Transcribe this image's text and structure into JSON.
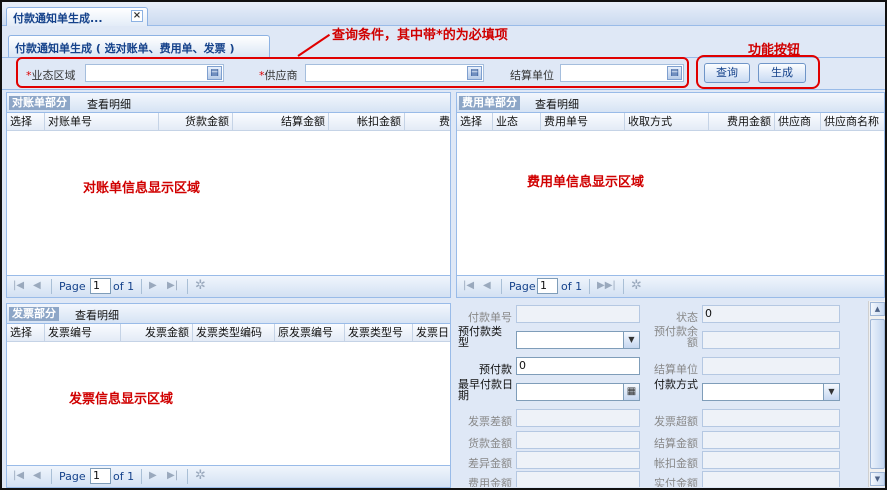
{
  "window": {
    "tab_title": "付款通知单生成...",
    "tab_close": "×"
  },
  "query_panel": {
    "tab_title": "付款通知单生成 ( 选对账单、费用单、发票 )",
    "required_mark": "*",
    "fields": [
      {
        "label": "业态区域",
        "required": true,
        "value": ""
      },
      {
        "label": "供应商",
        "required": true,
        "value": ""
      },
      {
        "label": "结算单位",
        "required": false,
        "value": ""
      }
    ],
    "buttons": {
      "query": "查询",
      "generate": "生成"
    }
  },
  "annotations": {
    "query_note": "查询条件，其中带*的为必填项",
    "button_note": "功能按钮"
  },
  "pager": {
    "page_label": "Page",
    "page_value": "1",
    "of_label": "of 1"
  },
  "statement_panel": {
    "title": "对账单部分",
    "detail_link": "查看明细",
    "columns": [
      "选择",
      "对账单号",
      "货款金额",
      "结算金额",
      "帐扣金额",
      "费"
    ],
    "area_label": "对账单信息显示区域"
  },
  "expense_panel": {
    "title": "费用单部分",
    "detail_link": "查看明细",
    "columns": [
      "选择",
      "业态",
      "费用单号",
      "收取方式",
      "费用金额",
      "供应商",
      "供应商名称"
    ],
    "area_label": "费用单信息显示区域"
  },
  "invoice_panel": {
    "title": "发票部分",
    "detail_link": "查看明细",
    "columns": [
      "选择",
      "发票编号",
      "发票金额",
      "发票类型编码",
      "原发票编号",
      "发票类型号",
      "发票日"
    ],
    "area_label": "发票信息显示区域"
  },
  "payment_form": {
    "payment_no": {
      "label": "付款单号",
      "value": ""
    },
    "status": {
      "label": "状态",
      "value": "0"
    },
    "prepay_type": {
      "label": "预付款类型",
      "value": ""
    },
    "prepay_balance": {
      "label": "预付款余额",
      "value": ""
    },
    "prepay": {
      "label": "预付款",
      "value": "0"
    },
    "settle_unit": {
      "label": "结算单位",
      "value": ""
    },
    "earliest_date": {
      "label": "最早付款日期",
      "value": ""
    },
    "pay_method": {
      "label": "付款方式",
      "value": ""
    },
    "invoice_diff": {
      "label": "发票差额",
      "value": ""
    },
    "invoice_over": {
      "label": "发票超额",
      "value": ""
    },
    "goods_amount": {
      "label": "货款金额",
      "value": ""
    },
    "settle_amount": {
      "label": "结算金额",
      "value": ""
    },
    "diff_amount": {
      "label": "差异金额",
      "value": ""
    },
    "deduct_amount": {
      "label": "帐扣金额",
      "value": ""
    },
    "expense_amount": {
      "label": "费用金额",
      "value": ""
    },
    "actual_amount": {
      "label": "实付金额",
      "value": ""
    }
  },
  "colors": {
    "accent": "#15428b",
    "annotation": "#d00000",
    "panel_bg": "#dfe8f6",
    "border": "#99bbe8"
  }
}
